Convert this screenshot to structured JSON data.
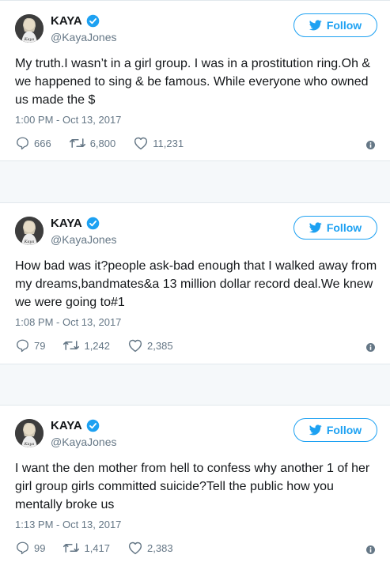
{
  "tweets": [
    {
      "name": "KAYA",
      "handle": "@KayaJones",
      "follow_label": "Follow",
      "text": "My truth.I wasn’t in a girl group. I was in a prostitution ring.Oh & we happened to sing & be famous. While everyone who owned us made the $",
      "time": "1:00 PM - Oct 13, 2017",
      "replies": "666",
      "retweets": "6,800",
      "likes": "11,231"
    },
    {
      "name": "KAYA",
      "handle": "@KayaJones",
      "follow_label": "Follow",
      "text": "How bad was it?people ask-bad enough that I walked away from my dreams,bandmates&a 13 million dollar record deal.We knew we were going to#1",
      "time": "1:08 PM - Oct 13, 2017",
      "replies": "79",
      "retweets": "1,242",
      "likes": "2,385"
    },
    {
      "name": "KAYA",
      "handle": "@KayaJones",
      "follow_label": "Follow",
      "text": "I want the den mother from hell to confess why another 1 of her girl group girls committed suicide?Tell the public how you mentally broke us",
      "time": "1:13 PM - Oct 13, 2017",
      "replies": "99",
      "retweets": "1,417",
      "likes": "2,383"
    }
  ],
  "colors": {
    "accent": "#1da1f2",
    "muted_text": "#657786",
    "text": "#14171a"
  },
  "icons": [
    "verified-badge-icon",
    "twitter-bird-icon",
    "reply-icon",
    "retweet-icon",
    "like-heart-icon",
    "info-icon"
  ]
}
